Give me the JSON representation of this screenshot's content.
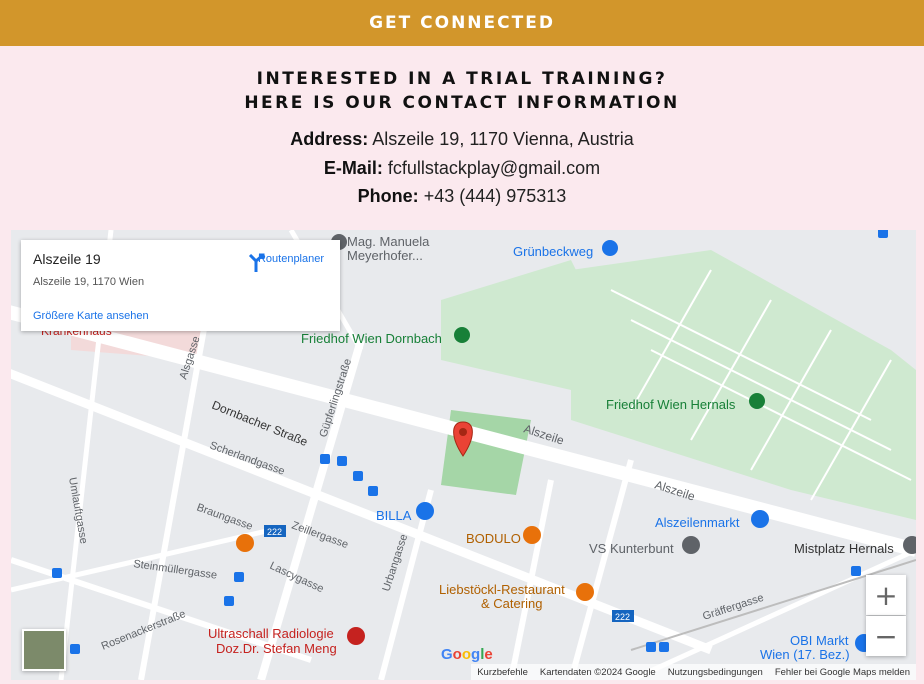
{
  "banner": {
    "title": "GET CONNECTED",
    "color": "#d2962b"
  },
  "heading": {
    "line1": "INTERESTED IN A TRIAL TRAINING?",
    "line2": "HERE IS OUR CONTACT INFORMATION"
  },
  "contact": {
    "address_label": "Address:",
    "address_value": "Alszeile 19, 1170 Vienna, Austria",
    "email_label": "E-Mail:",
    "email_value": "fcfullstackplay@gmail.com",
    "phone_label": "Phone:",
    "phone_value": "+43 (444) 975313"
  },
  "map": {
    "card": {
      "title": "Alszeile 19",
      "subtitle": "Alszeile 19, 1170 Wien",
      "route_label": "Routenplaner",
      "link": "Größere Karte ansehen"
    },
    "labels": {
      "manuela1": "Mag. Manuela",
      "manuela2": "Meyerhofer...",
      "gruenbeckweg": "Grünbeckweg",
      "friedhof_dornbach": "Friedhof Wien Dornbach",
      "friedhof_hernals": "Friedhof Wien Hernals",
      "krankenhaus": "Krankenhaus",
      "alsgasse": "Alsgasse",
      "dornbacher": "Dornbacher Straße",
      "guepferling": "Güpferlingstraße",
      "alszeile1": "Alszeile",
      "alszeile2": "Alszeile",
      "scherlandgasse": "Scherlandgasse",
      "umlauftgasse": "Umlauftgasse",
      "braungasse": "Braungasse",
      "zeillergasse": "Zeillergasse",
      "billa": "BILLA",
      "bodulo": "BODULO",
      "kunterbunt": "VS Kunterbunt",
      "alszeilenmarkt": "Alszeilenmarkt",
      "mistplatz": "Mistplatz Hernals",
      "steinmueller": "Steinmüllergasse",
      "lascygasse": "Lascygasse",
      "urbangasse": "Urbangasse",
      "liebstoeckl1": "Liebstöckl-Restaurant",
      "liebstoeckl2": "& Catering",
      "graeffergasse": "Gräffergasse",
      "rosenacker": "Rosenackerstraße",
      "ultraschall1": "Ultraschall Radiologie",
      "ultraschall2": "Doz.Dr. Stefan Meng",
      "obi1": "OBI Markt",
      "obi2": "Wien (17. Bez.)",
      "bus222a": "222",
      "bus222b": "222"
    },
    "google_logo": "Google",
    "footer": {
      "shortcuts": "Kurzbefehle",
      "mapdata": "Kartendaten ©2024 Google",
      "terms": "Nutzungsbedingungen",
      "report": "Fehler bei Google Maps melden"
    },
    "zoom_in": "+",
    "zoom_out": "−",
    "colors": {
      "park": "#c8e6c9",
      "marker": "#ea4335",
      "link": "#1a73e8"
    }
  }
}
